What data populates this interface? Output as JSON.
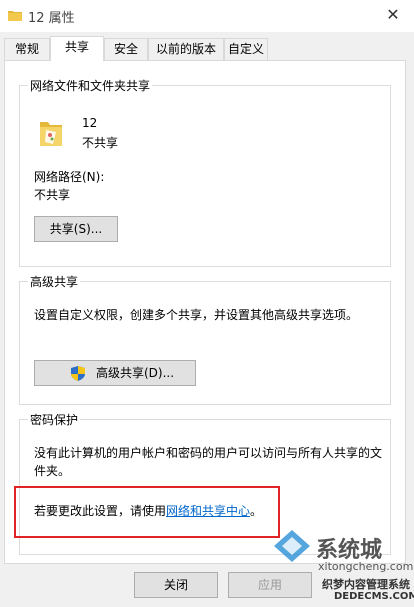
{
  "window": {
    "title": "12 属性",
    "close_glyph": "✕"
  },
  "tabs": [
    {
      "label": "常规"
    },
    {
      "label": "共享"
    },
    {
      "label": "安全"
    },
    {
      "label": "以前的版本"
    },
    {
      "label": "自定义"
    }
  ],
  "network_sharing": {
    "heading": "网络文件和文件夹共享",
    "item_name": "12",
    "item_status": "不共享",
    "path_label": "网络路径(N):",
    "path_value": "不共享",
    "share_button": "共享(S)..."
  },
  "advanced_sharing": {
    "heading": "高级共享",
    "description": "设置自定义权限，创建多个共享，并设置其他高级共享选项。",
    "button": "高级共享(D)..."
  },
  "password_protection": {
    "heading": "密码保护",
    "description_line1": "没有此计算机的用户帐户和密码的用户可以访问与所有人共享的文",
    "description_line2": "件夹。",
    "change_prefix": "若要更改此设置，请使用",
    "change_link": "网络和共享中心",
    "change_suffix": "。"
  },
  "footer": {
    "close_button": "关闭",
    "apply_button": "应用"
  },
  "watermark": {
    "brand_text": "系统城",
    "site_line": "xitongcheng.com",
    "overlay_name": "织梦内容管理系统",
    "overlay_url": "DEDECMS.COM"
  },
  "colors": {
    "highlight": "#e02424",
    "link": "#0066cc",
    "folder": "#f2c94c"
  }
}
